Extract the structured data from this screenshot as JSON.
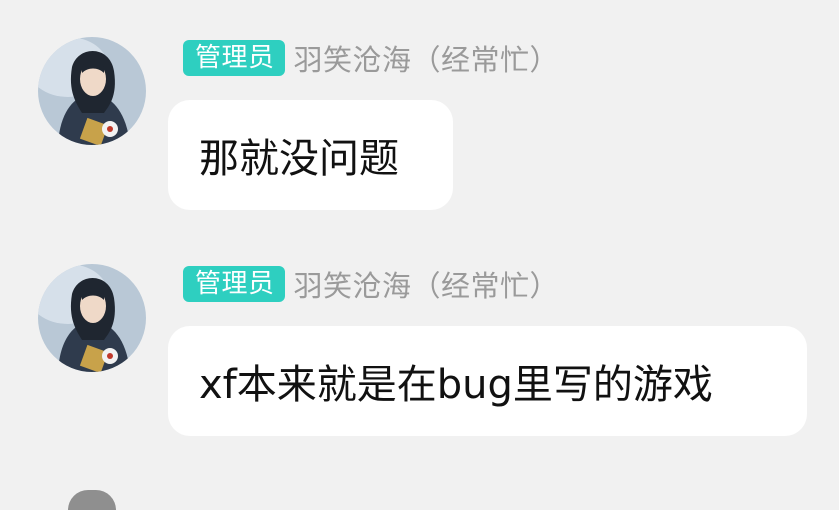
{
  "messages": [
    {
      "role_badge": "管理员",
      "sender": "羽笑沧海（经常忙）",
      "text": "那就没问题"
    },
    {
      "role_badge": "管理员",
      "sender": "羽笑沧海（经常忙）",
      "text": "xf本来就是在bug里写的游戏"
    }
  ]
}
